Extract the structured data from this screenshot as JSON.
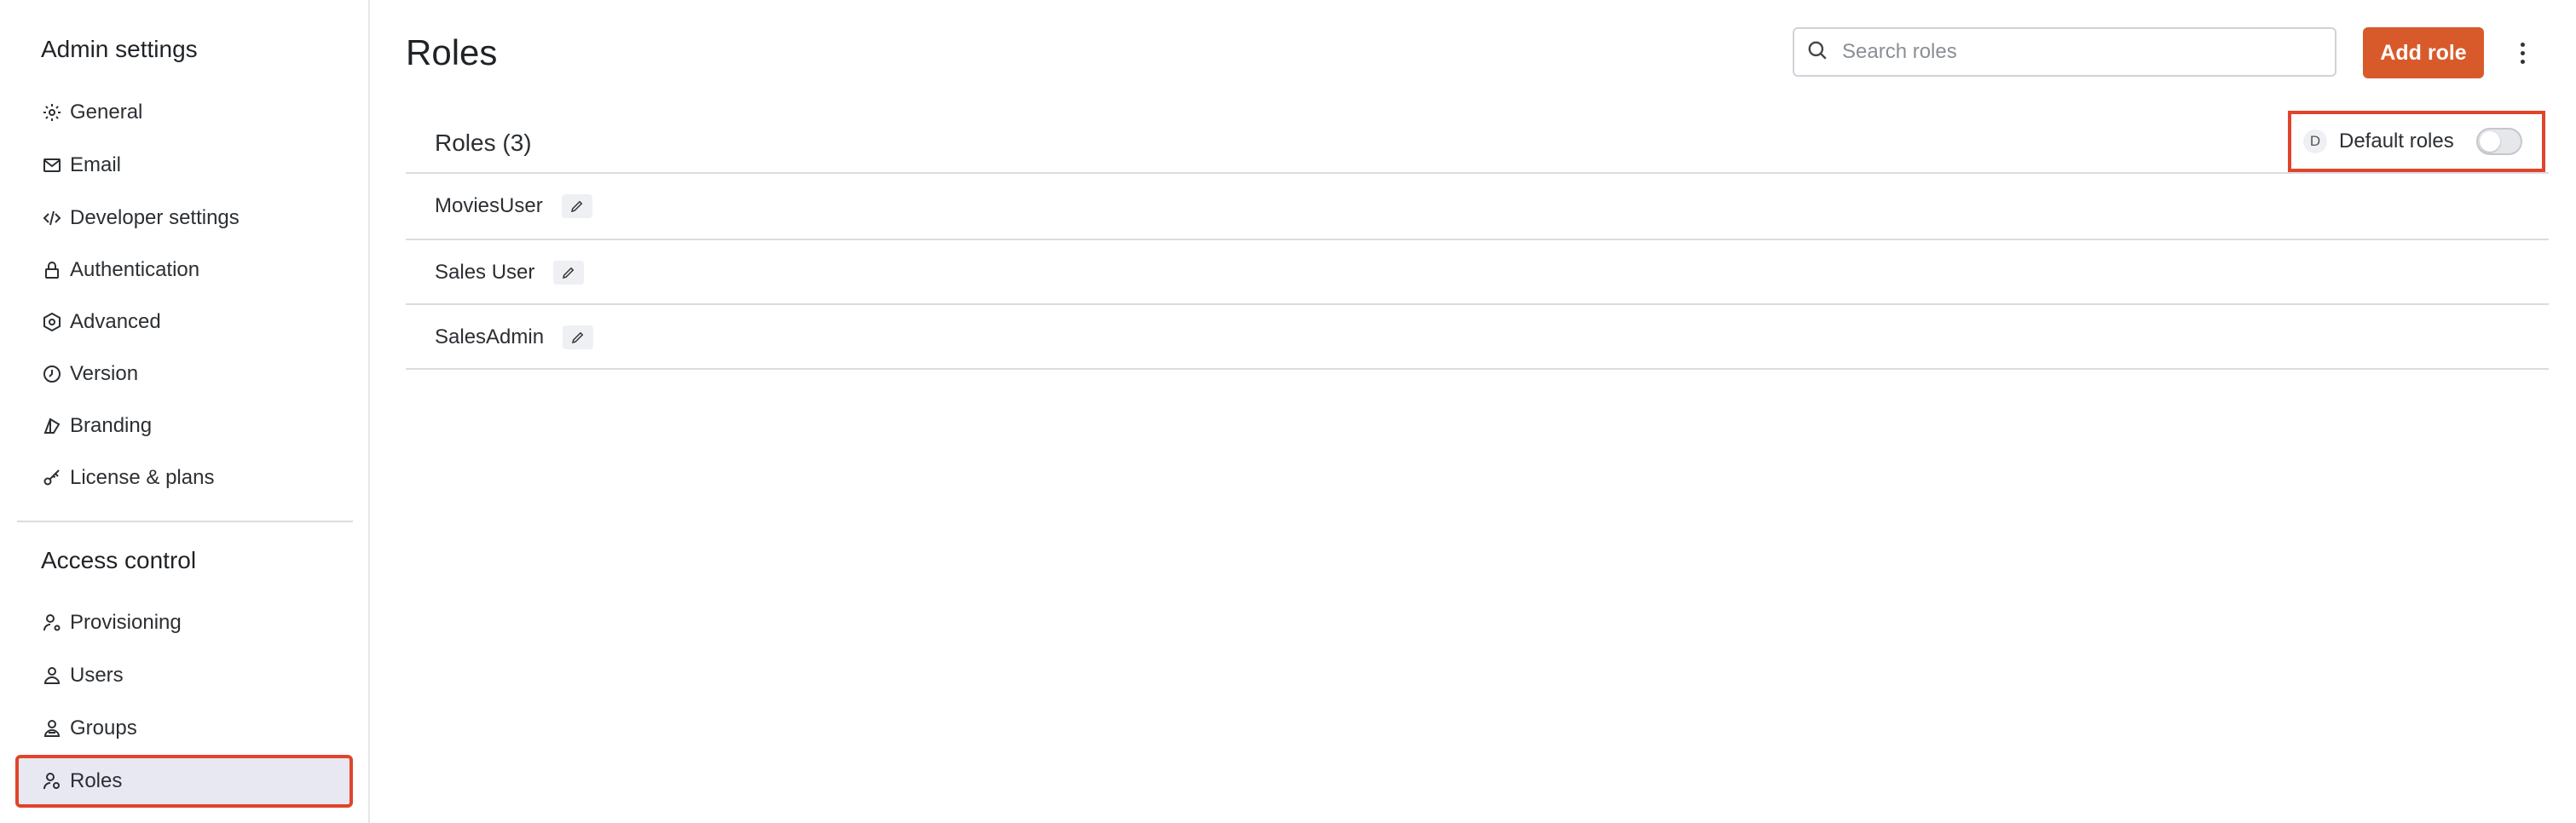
{
  "sidebar": {
    "admin_title": "Admin settings",
    "admin_items": [
      {
        "label": "General",
        "icon": "gear-icon"
      },
      {
        "label": "Email",
        "icon": "mail-icon"
      },
      {
        "label": "Developer settings",
        "icon": "code-icon"
      },
      {
        "label": "Authentication",
        "icon": "lock-icon"
      },
      {
        "label": "Advanced",
        "icon": "hex-gear-icon"
      },
      {
        "label": "Version",
        "icon": "clock-icon"
      },
      {
        "label": "Branding",
        "icon": "palette-icon"
      },
      {
        "label": "License & plans",
        "icon": "key-icon"
      }
    ],
    "access_title": "Access control",
    "access_items": [
      {
        "label": "Provisioning",
        "icon": "user-gear-icon"
      },
      {
        "label": "Users",
        "icon": "user-icon"
      },
      {
        "label": "Groups",
        "icon": "group-icon"
      },
      {
        "label": "Roles",
        "icon": "user-badge-icon",
        "active": true
      }
    ]
  },
  "main": {
    "title": "Roles",
    "search_placeholder": "Search roles",
    "add_button": "Add role",
    "roles_header": "Roles (3)",
    "default_badge": "D",
    "default_label": "Default roles",
    "default_toggle_on": false,
    "roles": [
      "MoviesUser",
      "Sales User",
      "SalesAdmin"
    ]
  },
  "colors": {
    "accent": "#d85a2a",
    "highlight_border": "#e0442b",
    "active_bg": "#e8e8f2"
  }
}
